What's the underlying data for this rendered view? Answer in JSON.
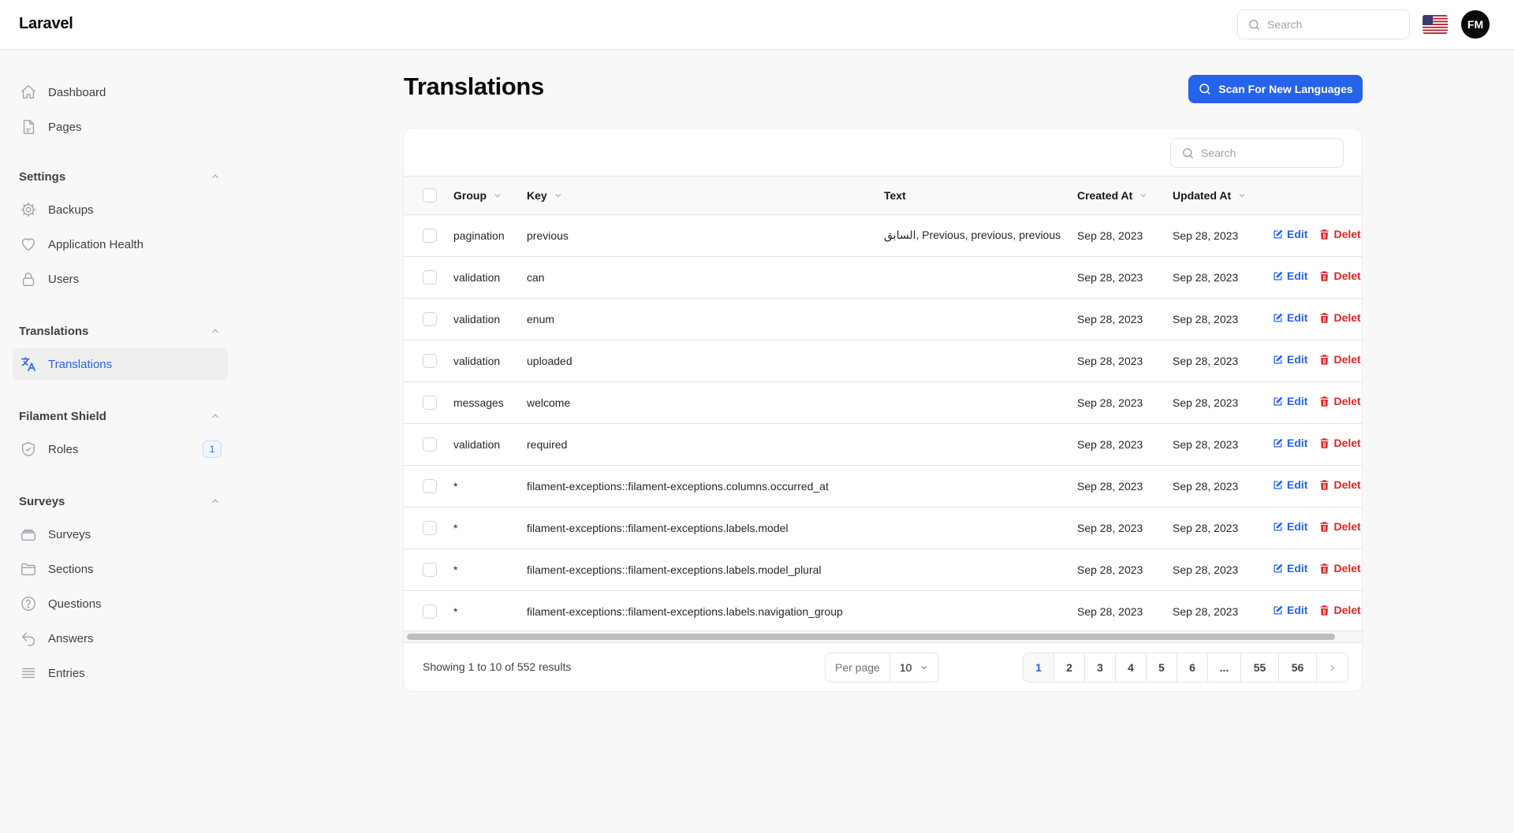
{
  "topbar": {
    "brand": "Laravel",
    "search_placeholder": "Search",
    "locale_flag": "us-flag",
    "avatar_initials": "FM"
  },
  "sidebar": {
    "items_top": [
      {
        "label": "Dashboard",
        "icon": "home-icon"
      },
      {
        "label": "Pages",
        "icon": "document-icon"
      }
    ],
    "groups": [
      {
        "label": "Settings",
        "items": [
          {
            "label": "Backups",
            "icon": "cog-icon"
          },
          {
            "label": "Application Health",
            "icon": "heart-icon"
          },
          {
            "label": "Users",
            "icon": "lock-icon"
          }
        ]
      },
      {
        "label": "Translations",
        "items": [
          {
            "label": "Translations",
            "icon": "language-icon",
            "active": true
          }
        ]
      },
      {
        "label": "Filament Shield",
        "items": [
          {
            "label": "Roles",
            "icon": "shield-check-icon",
            "badge": "1"
          }
        ]
      },
      {
        "label": "Surveys",
        "items": [
          {
            "label": "Surveys",
            "icon": "stack-icon"
          },
          {
            "label": "Sections",
            "icon": "folder-icon"
          },
          {
            "label": "Questions",
            "icon": "question-circle-icon"
          },
          {
            "label": "Answers",
            "icon": "reply-icon"
          },
          {
            "label": "Entries",
            "icon": "list-icon"
          }
        ]
      }
    ]
  },
  "main": {
    "title": "Translations",
    "scan_button": "Scan For New Languages",
    "table_search_placeholder": "Search",
    "columns": {
      "group": "Group",
      "key": "Key",
      "text": "Text",
      "created_at": "Created At",
      "updated_at": "Updated At"
    },
    "actions": {
      "edit": "Edit",
      "delete": "Delet"
    },
    "rows": [
      {
        "group": "pagination",
        "key": "previous",
        "text": "السابق, Previous, previous, previous",
        "created_at": "Sep 28, 2023",
        "updated_at": "Sep 28, 2023"
      },
      {
        "group": "validation",
        "key": "can",
        "text": "",
        "created_at": "Sep 28, 2023",
        "updated_at": "Sep 28, 2023"
      },
      {
        "group": "validation",
        "key": "enum",
        "text": "",
        "created_at": "Sep 28, 2023",
        "updated_at": "Sep 28, 2023"
      },
      {
        "group": "validation",
        "key": "uploaded",
        "text": "",
        "created_at": "Sep 28, 2023",
        "updated_at": "Sep 28, 2023"
      },
      {
        "group": "messages",
        "key": "welcome",
        "text": "",
        "created_at": "Sep 28, 2023",
        "updated_at": "Sep 28, 2023"
      },
      {
        "group": "validation",
        "key": "required",
        "text": "",
        "created_at": "Sep 28, 2023",
        "updated_at": "Sep 28, 2023"
      },
      {
        "group": "*",
        "key": "filament-exceptions::filament-exceptions.columns.occurred_at",
        "text": "",
        "created_at": "Sep 28, 2023",
        "updated_at": "Sep 28, 2023"
      },
      {
        "group": "*",
        "key": "filament-exceptions::filament-exceptions.labels.model",
        "text": "",
        "created_at": "Sep 28, 2023",
        "updated_at": "Sep 28, 2023"
      },
      {
        "group": "*",
        "key": "filament-exceptions::filament-exceptions.labels.model_plural",
        "text": "",
        "created_at": "Sep 28, 2023",
        "updated_at": "Sep 28, 2023"
      },
      {
        "group": "*",
        "key": "filament-exceptions::filament-exceptions.labels.navigation_group",
        "text": "",
        "created_at": "Sep 28, 2023",
        "updated_at": "Sep 28, 2023"
      }
    ],
    "footer": {
      "results": "Showing 1 to 10 of 552 results",
      "per_page_label": "Per page",
      "per_page_value": "10",
      "pages": [
        "1",
        "2",
        "3",
        "4",
        "5",
        "6",
        "...",
        "55",
        "56"
      ],
      "current_page": "1"
    }
  },
  "colors": {
    "primary": "#2563eb",
    "danger": "#dc2626",
    "background": "#f8f8f8"
  }
}
